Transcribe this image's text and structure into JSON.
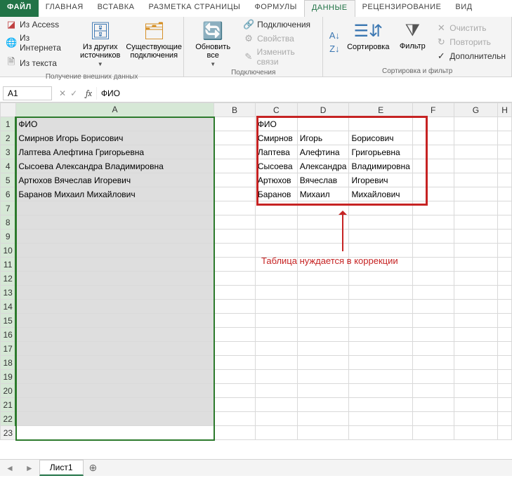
{
  "tabs": {
    "file": "ФАЙЛ",
    "home": "ГЛАВНАЯ",
    "insert": "ВСТАВКА",
    "layout": "РАЗМЕТКА СТРАНИЦЫ",
    "formulas": "ФОРМУЛЫ",
    "data": "ДАННЫЕ",
    "review": "РЕЦЕНЗИРОВАНИЕ",
    "view": "ВИД"
  },
  "ribbon": {
    "ext": {
      "access": "Из Access",
      "web": "Из Интернета",
      "text": "Из текста",
      "other": "Из других источников",
      "existing": "Существующие подключения",
      "label": "Получение внешних данных"
    },
    "conn": {
      "refresh": "Обновить все",
      "connections": "Подключения",
      "properties": "Свойства",
      "editlinks": "Изменить связи",
      "label": "Подключения"
    },
    "sort": {
      "az": "А↓Я",
      "za": "Я↓А",
      "sort": "Сортировка",
      "filter": "Фильтр",
      "clear": "Очистить",
      "reapply": "Повторить",
      "advanced": "Дополнительн",
      "label": "Сортировка и фильтр"
    }
  },
  "namebox": "A1",
  "formula": "ФИО",
  "columns": [
    "A",
    "B",
    "C",
    "D",
    "E",
    "F",
    "G",
    "H"
  ],
  "colA": [
    "ФИО",
    "Смирнов Игорь Борисович",
    "Лаптева Алефтина Григорьевна",
    "Сысоева Александра Владимировна",
    "Артюхов Вячеслав Игоревич",
    "Баранов Михаил Михайлович"
  ],
  "split": [
    [
      "ФИО",
      "",
      ""
    ],
    [
      "Смирнов",
      "Игорь",
      "Борисович"
    ],
    [
      "Лаптева",
      "Алефтина",
      "Григорьевна"
    ],
    [
      "Сысоева",
      "Александра",
      "Владимировна"
    ],
    [
      "Артюхов",
      "Вячеслав",
      "Игоревич"
    ],
    [
      "Баранов",
      "Михаил",
      "Михайлович"
    ]
  ],
  "annotation": "Таблица нуждается в коррекции",
  "sheet": "Лист1"
}
